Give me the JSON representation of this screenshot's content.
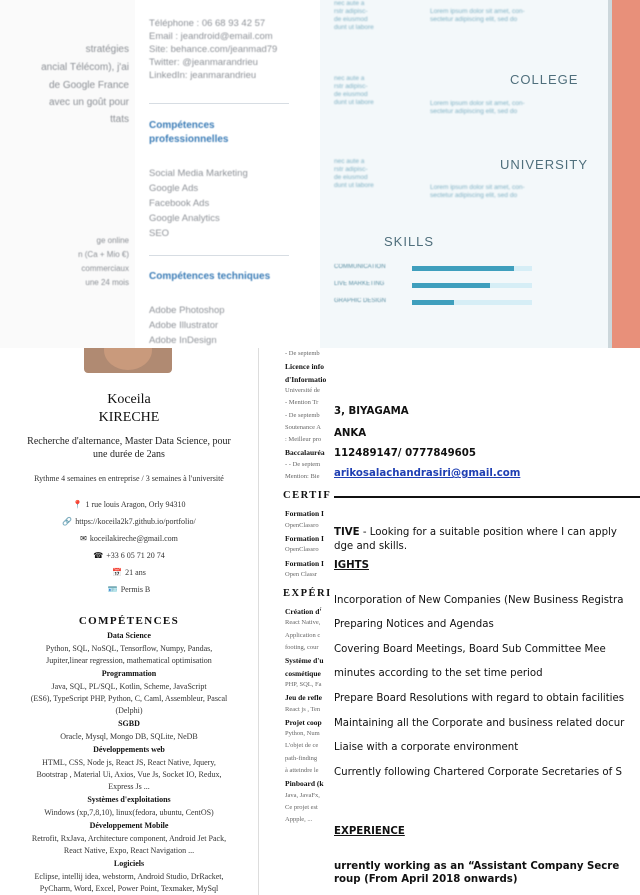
{
  "panel_a": {
    "lines": [
      "stratégies",
      "ancial Télécom), j'ai",
      "de Google France",
      "avec un goût pour",
      "ttats",
      "ge online",
      "n (Ca + Mio €)",
      "commerciaux",
      "une 24 mois"
    ]
  },
  "panel_b": {
    "contacts": [
      "Téléphone : 06 68 93 42 57",
      "Email : jeandroid@email.com",
      "Site: behance.com/jeanmad79",
      "Twitter: @jeanmarandrieu",
      "LinkedIn: jeanmarandrieu"
    ],
    "pro_heading_1": "Compétences",
    "pro_heading_2": "professionnelles",
    "pro_skills": [
      "Social Media Marketing",
      "Google Ads",
      "Facebook Ads",
      "Google Analytics",
      "SEO"
    ],
    "tech_heading": "Compétences techniques",
    "tech_skills": [
      "Adobe Photoshop",
      "Adobe Illustrator",
      "Adobe InDesign"
    ]
  },
  "panel_c": {
    "blur_left": "nec aute a\nrstr adipisc-\nde eiusmod\ndunt ut labore",
    "blur_right": "Lorem ipsum dolor sit amet, con-\nsectetur adipiscing elit, sed do",
    "college": "COLLEGE",
    "university": "UNIVERSITY",
    "skills_title": "SKILLS",
    "skills": [
      {
        "name": "COMMUNICATION",
        "level": 0.85
      },
      {
        "name": "LIVE MARKETING",
        "level": 0.65
      },
      {
        "name": "GRAPHIC DESIGN",
        "level": 0.35
      }
    ]
  },
  "panel_d": {
    "first_name": "Koceila",
    "last_name": "KIRECHE",
    "headline_1": "Recherche d'alternance, Master Data Science, pour",
    "headline_2": "une durée de 2ans",
    "rhythm": "Rythme 4 semaines en entreprise / 3 semaines à l'université",
    "address": "1 rue louis Aragon, Orly 94310",
    "portfolio": "https://koceila2k7.github.io/portfolio/",
    "email": "koceilakireche@gmail.com",
    "phone": "+33 6 05 71 20 74",
    "age": "21 ans",
    "license": "Permis B",
    "competences_title": "COMPÉTENCES",
    "groups": [
      {
        "title": "Data Science",
        "lines": [
          "Python, SQL, NoSQL, Tensorflow, Numpy, Pandas,",
          "Jupiter,linear regression, mathematical optimisation"
        ]
      },
      {
        "title": "Programmation",
        "lines": [
          "Java, SQL, PL/SQL, Kotlin, Scheme, JavaScript",
          "(ES6), TypeScript PHP, Python, C, Caml, Assembleur, Pascal",
          "(Delphi)"
        ]
      },
      {
        "title": "SGBD",
        "lines": [
          "Oracle, Mysql, Mongo DB, SQLite, NeDB"
        ]
      },
      {
        "title": "Développements web",
        "lines": [
          "HTML, CSS, Node js, React JS, React Native, Jquery,",
          "Bootstrap , Material Ui, Axios, Vue Js, Socket IO, Redux,",
          "Express Js ..."
        ]
      },
      {
        "title": "Systèmes d'exploitations",
        "lines": [
          "Windows (xp,7,8,10), linux(fedora, ubuntu, CentOS)"
        ]
      },
      {
        "title": "Développement Mobile",
        "lines": [
          "Eclipse, intellij idea, webstorm, Android Studio, DrRacket,",
          "Retrofit, RxJava, Architecture component, Android Jet Pack,",
          "React Native, Expo, React Navigation ..."
        ]
      },
      {
        "title": "Logiciels",
        "lines": [
          "Eclipse, intellij idea, webstorm, Android Studio, DrRacket,",
          "PyCharm, Word, Excel, Power Point, Texmaker, MySql"
        ]
      }
    ]
  },
  "panel_e": {
    "lines": [
      {
        "k": "t",
        "v": "- De septemb"
      },
      {
        "k": "b",
        "v": "Licence info"
      },
      {
        "k": "b",
        "v": "d'Informatio"
      },
      {
        "k": "t",
        "v": "Université de"
      },
      {
        "k": "t",
        "v": "- Mention Tr"
      },
      {
        "k": "t",
        "v": "- De septemb"
      },
      {
        "k": "t",
        "v": "Soutenance A"
      },
      {
        "k": "t",
        "v": ": Meilleur pro"
      },
      {
        "k": "b",
        "v": "Baccalauréa"
      },
      {
        "k": "t",
        "v": "- - De septem"
      },
      {
        "k": "t",
        "v": "Mention: Bie"
      },
      {
        "k": "s",
        "v": "CERTIF"
      },
      {
        "k": "b",
        "v": "Formation I"
      },
      {
        "k": "t",
        "v": "OpenClassro"
      },
      {
        "k": "b",
        "v": "Formation I"
      },
      {
        "k": "t",
        "v": "OpenClassro"
      },
      {
        "k": "b",
        "v": "Formation I"
      },
      {
        "k": "t",
        "v": "Open Classr"
      },
      {
        "k": "s",
        "v": "EXPÉRI"
      },
      {
        "k": "b",
        "v": "Création d'́"
      },
      {
        "k": "t",
        "v": "React Native,"
      },
      {
        "k": "t",
        "v": "Application c"
      },
      {
        "k": "t",
        "v": "footing, cour"
      },
      {
        "k": "b",
        "v": "Système d'u"
      },
      {
        "k": "b",
        "v": "cosmétique"
      },
      {
        "k": "t",
        "v": "PHP, SQL, Fa"
      },
      {
        "k": "b",
        "v": "Jeu de refle"
      },
      {
        "k": "t",
        "v": "React js , Ten"
      },
      {
        "k": "b",
        "v": "Projet coop"
      },
      {
        "k": "t",
        "v": "Python, Num"
      },
      {
        "k": "t",
        "v": "L'objet de ce"
      },
      {
        "k": "t",
        "v": "path-finding"
      },
      {
        "k": "t",
        "v": "à atteindre le"
      },
      {
        "k": "b",
        "v": "Pinboard (k"
      },
      {
        "k": "t",
        "v": "Java, JavaFx,"
      },
      {
        "k": "t",
        "v": "Ce projet est"
      },
      {
        "k": "t",
        "v": "Appple, ..."
      }
    ]
  },
  "panel_f": {
    "name_line": "3, BIYAGAMA",
    "country_line": "ANKA",
    "phones": "112489147/ 0777849605",
    "email": "arikosalachandrasiri@gmail.com",
    "objective_label": "TIVE",
    "objective_text": " - Looking for a suitable position where I can apply",
    "objective_cont": "dge and skills.",
    "highlights_title": "IGHTS",
    "items": [
      "Incorporation of  New Companies (New Business Registra",
      "Preparing Notices and Agendas",
      "Covering  Board  Meetings,  Board  Sub  Committee  Mee",
      "minutes according to the set time period",
      "Prepare Board Resolutions with regard to obtain facilities",
      "Maintaining all the Corporate and business related docur",
      "Liaise with a corporate environment",
      "Currently following Chartered Corporate Secretaries of  S"
    ],
    "experience_title": "EXPERIENCE",
    "exp_line_1": "urrently working as an “Assistant Company Secre",
    "exp_line_2": "roup (From April 2018 onwards)"
  }
}
